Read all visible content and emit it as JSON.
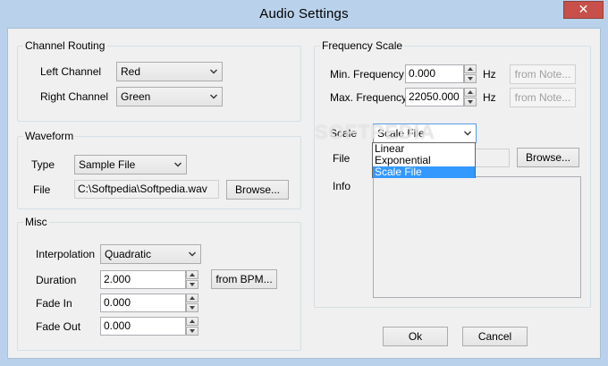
{
  "window": {
    "title": "Audio Settings",
    "close_symbol": "✕"
  },
  "channel_routing": {
    "title": "Channel Routing",
    "left_label": "Left Channel",
    "left_value": "Red",
    "right_label": "Right Channel",
    "right_value": "Green"
  },
  "waveform": {
    "title": "Waveform",
    "type_label": "Type",
    "type_value": "Sample File",
    "file_label": "File",
    "file_value": "C:\\Softpedia\\Softpedia.wav",
    "browse_label": "Browse..."
  },
  "misc": {
    "title": "Misc",
    "interpolation_label": "Interpolation",
    "interpolation_value": "Quadratic",
    "duration_label": "Duration",
    "duration_value": "2.000",
    "from_bpm_label": "from BPM...",
    "fade_in_label": "Fade In",
    "fade_in_value": "0.000",
    "fade_out_label": "Fade Out",
    "fade_out_value": "0.000"
  },
  "frequency_scale": {
    "title": "Frequency Scale",
    "min_label": "Min. Frequency",
    "min_value": "0.000",
    "min_unit": "Hz",
    "min_from_note": "from Note...",
    "max_label": "Max. Frequency",
    "max_value": "22050.000",
    "max_unit": "Hz",
    "max_from_note": "from Note...",
    "scale_label": "Scale",
    "scale_value": "Scale File",
    "scale_options": [
      "Linear",
      "Exponential",
      "Scale File"
    ],
    "file_label": "File",
    "browse_label": "Browse...",
    "info_label": "Info"
  },
  "footer": {
    "ok_label": "Ok",
    "cancel_label": "Cancel"
  },
  "watermark": "SOFTPEDIA"
}
